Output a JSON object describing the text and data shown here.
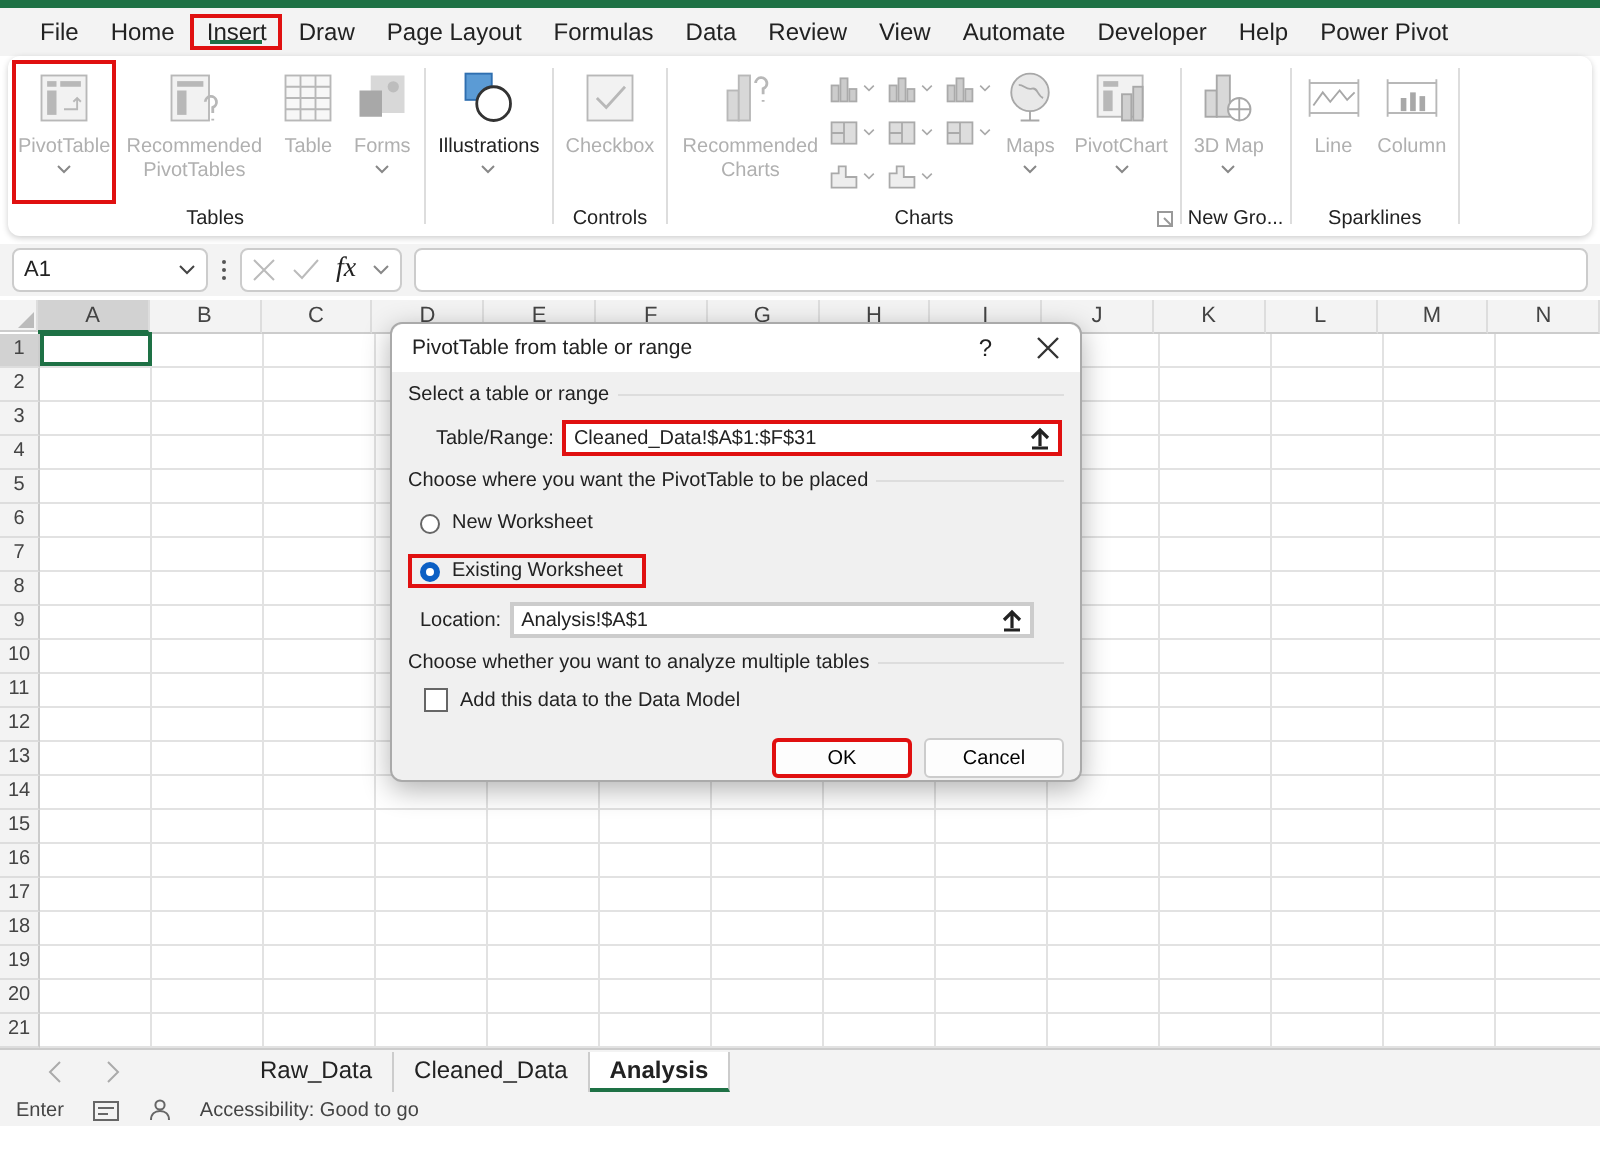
{
  "menu_tabs": [
    {
      "label": "File",
      "selected": false
    },
    {
      "label": "Home",
      "selected": false
    },
    {
      "label": "Insert",
      "selected": true,
      "highlighted": true
    },
    {
      "label": "Draw",
      "selected": false
    },
    {
      "label": "Page Layout",
      "selected": false
    },
    {
      "label": "Formulas",
      "selected": false
    },
    {
      "label": "Data",
      "selected": false
    },
    {
      "label": "Review",
      "selected": false
    },
    {
      "label": "View",
      "selected": false
    },
    {
      "label": "Automate",
      "selected": false
    },
    {
      "label": "Developer",
      "selected": false
    },
    {
      "label": "Help",
      "selected": false
    },
    {
      "label": "Power Pivot",
      "selected": false
    }
  ],
  "ribbon": {
    "groups": [
      {
        "label": "Tables",
        "items": [
          {
            "kind": "large",
            "label": "PivotTable",
            "caret": true,
            "disabled": true,
            "highlighted": true
          },
          {
            "kind": "large",
            "label": "Recommended PivotTables",
            "disabled": true
          },
          {
            "kind": "large",
            "label": "Table",
            "disabled": true
          },
          {
            "kind": "large",
            "label": "Forms",
            "caret": true,
            "disabled": true
          }
        ]
      },
      {
        "items": [
          {
            "kind": "large",
            "label": "Illustrations",
            "caret": true,
            "disabled": false
          }
        ]
      },
      {
        "label": "Controls",
        "items": [
          {
            "kind": "large",
            "label": "Checkbox",
            "disabled": true
          }
        ]
      },
      {
        "label": "Charts",
        "launcher": true,
        "items": [
          {
            "kind": "large",
            "label": "Recommended Charts",
            "disabled": true
          },
          {
            "kind": "gallery",
            "caret": true,
            "disabled": true
          },
          {
            "kind": "large",
            "label": "Maps",
            "caret": true,
            "disabled": true
          },
          {
            "kind": "large",
            "label": "PivotChart",
            "caret": true,
            "disabled": true
          }
        ]
      },
      {
        "label": "New Gro...",
        "items": [
          {
            "kind": "large",
            "label": "3D Map",
            "caret": true,
            "disabled": true
          }
        ]
      },
      {
        "label": "Sparklines",
        "items": [
          {
            "kind": "large",
            "label": "Line",
            "disabled": true
          },
          {
            "kind": "large",
            "label": "Column",
            "disabled": true
          }
        ]
      }
    ]
  },
  "formula_bar": {
    "name_box": "A1",
    "fx": "fx"
  },
  "sheet": {
    "columns": [
      {
        "label": "A",
        "selected": true
      },
      {
        "label": "B",
        "selected": false
      },
      {
        "label": "C",
        "selected": false
      },
      {
        "label": "D",
        "selected": false
      },
      {
        "label": "E",
        "selected": false
      },
      {
        "label": "F",
        "selected": false
      },
      {
        "label": "G",
        "selected": false
      },
      {
        "label": "H",
        "selected": false
      },
      {
        "label": "I",
        "selected": false
      },
      {
        "label": "J",
        "selected": false
      },
      {
        "label": "K",
        "selected": false
      },
      {
        "label": "L",
        "selected": false
      },
      {
        "label": "M",
        "selected": false
      },
      {
        "label": "N",
        "selected": false
      }
    ],
    "rows": [
      {
        "label": "1",
        "selected": true
      },
      {
        "label": "2",
        "selected": false
      },
      {
        "label": "3",
        "selected": false
      },
      {
        "label": "4",
        "selected": false
      },
      {
        "label": "5",
        "selected": false
      },
      {
        "label": "6",
        "selected": false
      },
      {
        "label": "7",
        "selected": false
      },
      {
        "label": "8",
        "selected": false
      },
      {
        "label": "9",
        "selected": false
      },
      {
        "label": "10",
        "selected": false
      },
      {
        "label": "11",
        "selected": false
      },
      {
        "label": "12",
        "selected": false
      },
      {
        "label": "13",
        "selected": false
      },
      {
        "label": "14",
        "selected": false
      },
      {
        "label": "15",
        "selected": false
      },
      {
        "label": "16",
        "selected": false
      },
      {
        "label": "17",
        "selected": false
      },
      {
        "label": "18",
        "selected": false
      },
      {
        "label": "19",
        "selected": false
      },
      {
        "label": "20",
        "selected": false
      },
      {
        "label": "21",
        "selected": false
      }
    ]
  },
  "dialog": {
    "title": "PivotTable from table or range",
    "help": "?",
    "section_1": "Select a table or range",
    "range_label": "Table/Range:",
    "range_value": "Cleaned_Data!$A$1:$F$31",
    "range_highlighted": true,
    "section_2": "Choose where you want the PivotTable to be placed",
    "placement_options": [
      {
        "label": "New Worksheet",
        "selected": false
      },
      {
        "label": "Existing Worksheet",
        "selected": true,
        "highlighted": true
      }
    ],
    "location_label": "Location:",
    "location_value": "Analysis!$A$1",
    "section_3": "Choose whether you want to analyze multiple tables",
    "data_model": {
      "label": "Add this data to the Data Model",
      "checked": false
    },
    "buttons": [
      {
        "label": "OK",
        "default": true,
        "highlighted": true
      },
      {
        "label": "Cancel",
        "default": false
      }
    ]
  },
  "sheet_tabs": [
    {
      "label": "Raw_Data",
      "selected": false
    },
    {
      "label": "Cleaned_Data",
      "selected": false
    },
    {
      "label": "Analysis",
      "selected": true
    }
  ],
  "status_bar": {
    "mode": "Enter",
    "accessibility": "Accessibility: Good to go"
  }
}
